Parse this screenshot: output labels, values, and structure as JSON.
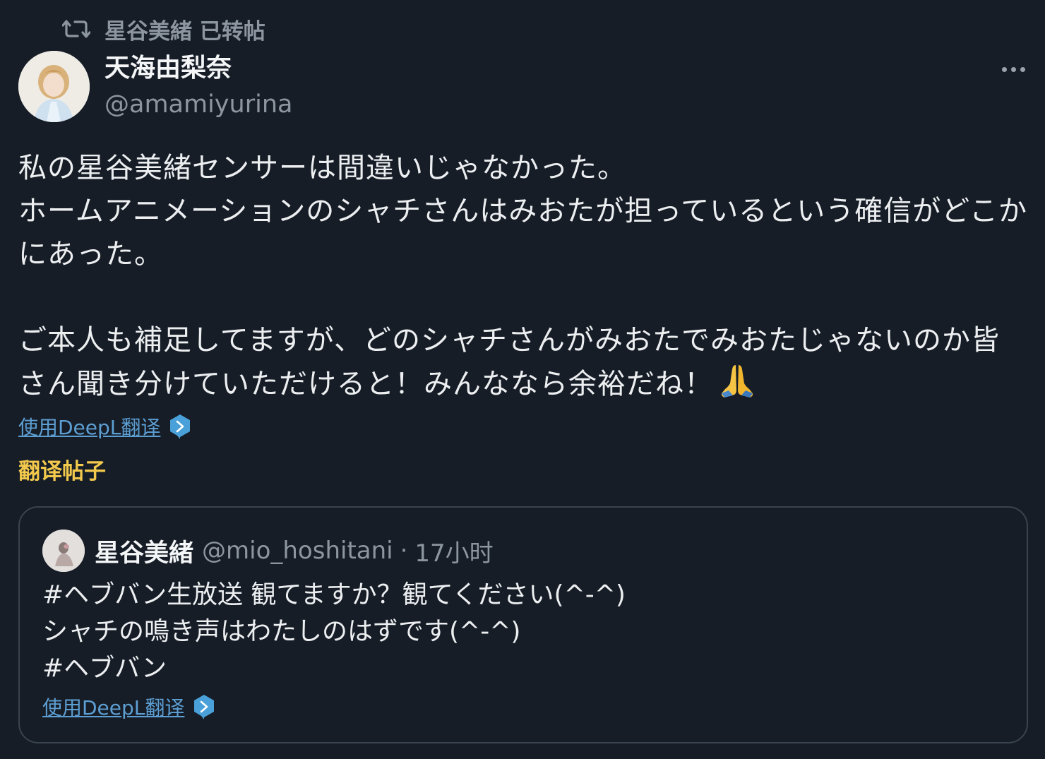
{
  "retweet": {
    "icon": "retweet-icon",
    "label": "星谷美緒 已转帖"
  },
  "author": {
    "name": "天海由梨奈",
    "handle": "@amamiyurina",
    "avatar": "avatar-photo"
  },
  "tweet": {
    "text": "私の星谷美緒センサーは間違いじゃなかった。\nホームアニメーションのシャチさんはみおたが担っているという確信がどこかにあった。\n\nご本人も補足してますが、どのシャチさんがみおたでみおたじゃないのか皆さん聞き分けていただけると！みんななら余裕だね！",
    "emoji": "🙏"
  },
  "deepl": {
    "label": "使用DeepL翻译",
    "icon": "deepl-icon"
  },
  "translate_post": "翻译帖子",
  "quote": {
    "name": "星谷美緒",
    "handle": "@mio_hoshitani",
    "separator": "·",
    "time": "17小时",
    "text": "#ヘブバン生放送 観てますか？観てください(^-^)\nシャチの鳴き声はわたしのはずです(^-^)\n#ヘブバン",
    "deepl_label": "使用DeepL翻译"
  },
  "colors": {
    "background": "#161d27",
    "muted": "#8d96a0",
    "link": "#5d9fd3",
    "accent": "#f2c94c",
    "border": "#3a434e"
  }
}
